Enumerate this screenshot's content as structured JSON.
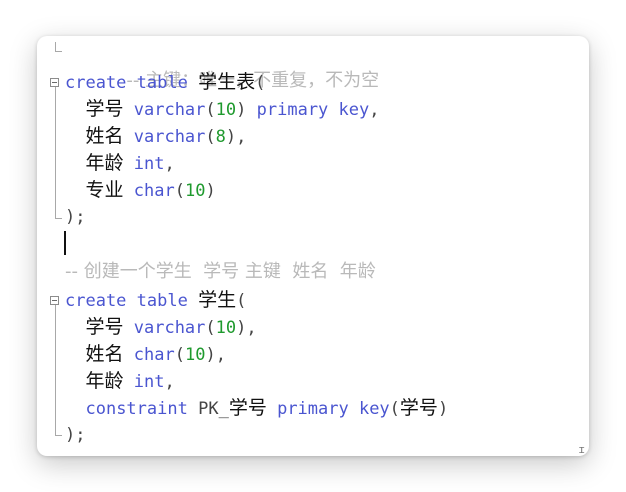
{
  "editor": {
    "lines": [
      {
        "comment": "-- 主键：唯一，不重复，不为空"
      },
      {
        "kw1": "create",
        "kw2": "table",
        "name": "学生表",
        "punc": "("
      },
      {
        "col": "学号",
        "type": "varchar",
        "open": "(",
        "num": "10",
        "close": ")",
        "kw3": "primary key",
        "punc": ","
      },
      {
        "col": "姓名",
        "type": "varchar",
        "open": "(",
        "num": "8",
        "close": ")",
        "punc": ","
      },
      {
        "col": "年龄",
        "type": "int",
        "punc": ","
      },
      {
        "col": "专业",
        "type": "char",
        "open": "(",
        "num": "10",
        "close": ")"
      },
      {
        "text": ");"
      },
      {
        "comment": "-- 创建一个学生  学号 主键  姓名  年龄"
      },
      {
        "kw1": "create",
        "kw2": "table",
        "name": "学生",
        "punc": "("
      },
      {
        "col": "学号",
        "type": "varchar",
        "open": "(",
        "num": "10",
        "close": ")",
        "punc": ","
      },
      {
        "col": "姓名",
        "type": "char",
        "open": "(",
        "num": "10",
        "close": ")",
        "punc": ","
      },
      {
        "col": "年龄",
        "type": "int",
        "punc": ","
      },
      {
        "kw1": "constraint",
        "ident": "PK_",
        "col": "学号",
        "kw3": "primary key",
        "open": "(",
        "arg": "学号",
        "close": ")"
      },
      {
        "text": ");"
      }
    ],
    "corner_glyph": "ɪ"
  }
}
